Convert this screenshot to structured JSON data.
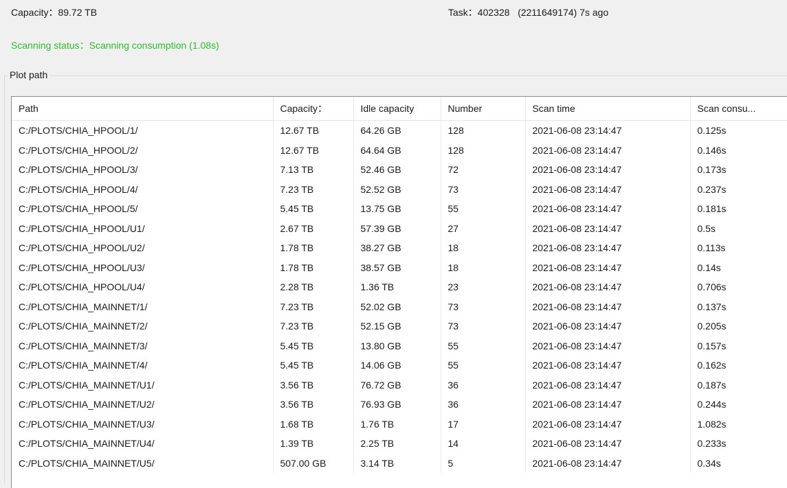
{
  "header": {
    "capacity_label": "Capacity：",
    "capacity_value": "89.72 TB",
    "task_label": "Task：",
    "task_value": "402328",
    "task_detail": "(2211649174) 7s ago"
  },
  "status": {
    "label": "Scanning status：",
    "value": "Scanning consumption (1.08s)",
    "color": "#2eb82e"
  },
  "plot_path": {
    "title": "Plot path",
    "columns": [
      "Path",
      "Capacity：",
      "Idle capacity",
      "Number",
      "Scan time",
      "Scan consu..."
    ],
    "rows": [
      [
        "C:/PLOTS/CHIA_HPOOL/1/",
        "12.67 TB",
        "64.26 GB",
        "128",
        "2021-06-08 23:14:47",
        "0.125s"
      ],
      [
        "C:/PLOTS/CHIA_HPOOL/2/",
        "12.67 TB",
        "64.64 GB",
        "128",
        "2021-06-08 23:14:47",
        "0.146s"
      ],
      [
        "C:/PLOTS/CHIA_HPOOL/3/",
        "7.13 TB",
        "52.46 GB",
        "72",
        "2021-06-08 23:14:47",
        "0.173s"
      ],
      [
        "C:/PLOTS/CHIA_HPOOL/4/",
        "7.23 TB",
        "52.52 GB",
        "73",
        "2021-06-08 23:14:47",
        "0.237s"
      ],
      [
        "C:/PLOTS/CHIA_HPOOL/5/",
        "5.45 TB",
        "13.75 GB",
        "55",
        "2021-06-08 23:14:47",
        "0.181s"
      ],
      [
        "C:/PLOTS/CHIA_HPOOL/U1/",
        "2.67 TB",
        "57.39 GB",
        "27",
        "2021-06-08 23:14:47",
        "0.5s"
      ],
      [
        "C:/PLOTS/CHIA_HPOOL/U2/",
        "1.78 TB",
        "38.27 GB",
        "18",
        "2021-06-08 23:14:47",
        "0.113s"
      ],
      [
        "C:/PLOTS/CHIA_HPOOL/U3/",
        "1.78 TB",
        "38.57 GB",
        "18",
        "2021-06-08 23:14:47",
        "0.14s"
      ],
      [
        "C:/PLOTS/CHIA_HPOOL/U4/",
        "2.28 TB",
        "1.36 TB",
        "23",
        "2021-06-08 23:14:47",
        "0.706s"
      ],
      [
        "C:/PLOTS/CHIA_MAINNET/1/",
        "7.23 TB",
        "52.02 GB",
        "73",
        "2021-06-08 23:14:47",
        "0.137s"
      ],
      [
        "C:/PLOTS/CHIA_MAINNET/2/",
        "7.23 TB",
        "52.15 GB",
        "73",
        "2021-06-08 23:14:47",
        "0.205s"
      ],
      [
        "C:/PLOTS/CHIA_MAINNET/3/",
        "5.45 TB",
        "13.80 GB",
        "55",
        "2021-06-08 23:14:47",
        "0.157s"
      ],
      [
        "C:/PLOTS/CHIA_MAINNET/4/",
        "5.45 TB",
        "14.06 GB",
        "55",
        "2021-06-08 23:14:47",
        "0.162s"
      ],
      [
        "C:/PLOTS/CHIA_MAINNET/U1/",
        "3.56 TB",
        "76.72 GB",
        "36",
        "2021-06-08 23:14:47",
        "0.187s"
      ],
      [
        "C:/PLOTS/CHIA_MAINNET/U2/",
        "3.56 TB",
        "76.93 GB",
        "36",
        "2021-06-08 23:14:47",
        "0.244s"
      ],
      [
        "C:/PLOTS/CHIA_MAINNET/U3/",
        "1.68 TB",
        "1.76 TB",
        "17",
        "2021-06-08 23:14:47",
        "1.082s"
      ],
      [
        "C:/PLOTS/CHIA_MAINNET/U4/",
        "1.39 TB",
        "2.25 TB",
        "14",
        "2021-06-08 23:14:47",
        "0.233s"
      ],
      [
        "C:/PLOTS/CHIA_MAINNET/U5/",
        "507.00 GB",
        "3.14 TB",
        "5",
        "2021-06-08 23:14:47",
        "0.34s"
      ]
    ]
  }
}
